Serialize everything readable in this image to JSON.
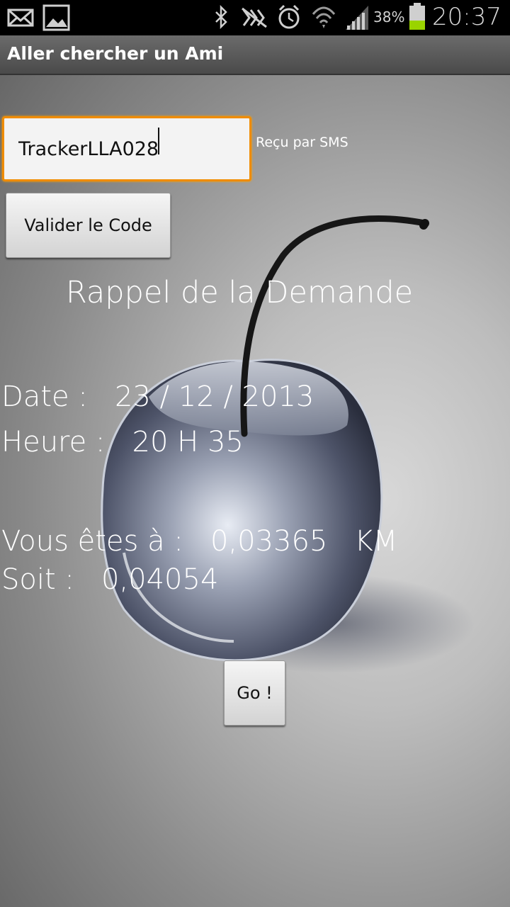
{
  "status_bar": {
    "battery_percent": "38%",
    "time": "20:37",
    "icons": [
      "mail-icon",
      "image-icon",
      "bluetooth-icon",
      "nfc-icon",
      "alarm-icon",
      "wifi-icon",
      "signal-icon",
      "battery-icon"
    ],
    "battery_level": 0.38,
    "battery_color": "#9ad300"
  },
  "title_bar": {
    "title": "Aller chercher un Ami"
  },
  "form": {
    "code_value": "TrackerLLA028",
    "sms_label": "Reçu par SMS",
    "validate_label": "Valider le Code",
    "accent_color": "#f08c00"
  },
  "details": {
    "heading": "Rappel de la Demande",
    "date_line": "Date :   23 / 12 / 2013",
    "time_line": "Heure :   20 H 35",
    "distance_line": "Vous êtes à :   0,03365   KM",
    "soit_line": "Soit :   0,04054"
  },
  "actions": {
    "go_label": "Go !"
  }
}
